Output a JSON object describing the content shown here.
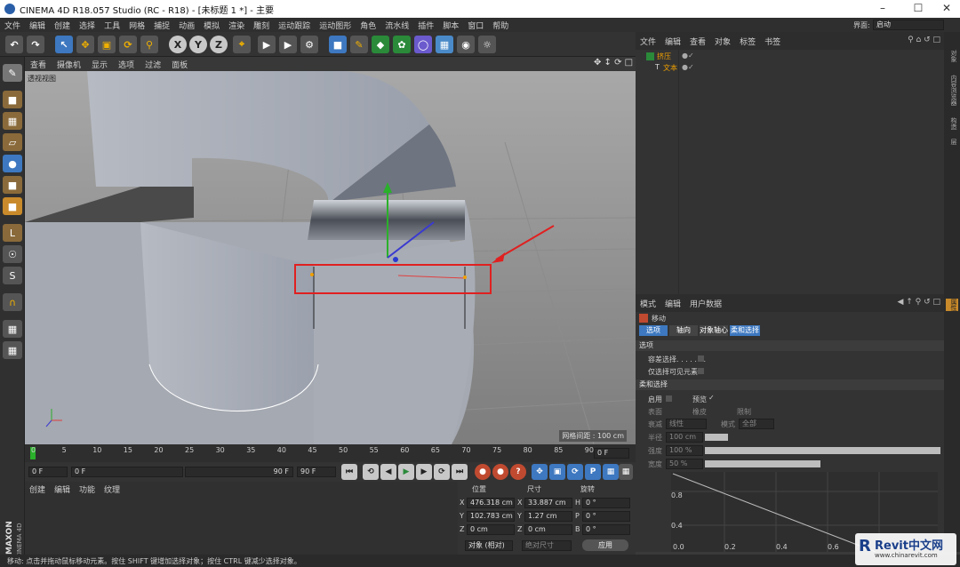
{
  "window": {
    "title": "CINEMA 4D R18.057 Studio (RC - R18) - [未标题 1 *] - 主要"
  },
  "menubar": {
    "items": [
      "文件",
      "编辑",
      "创建",
      "选择",
      "工具",
      "网格",
      "捕捉",
      "动画",
      "模拟",
      "渲染",
      "雕刻",
      "运动跟踪",
      "运动图形",
      "角色",
      "流水线",
      "插件",
      "脚本",
      "窗口",
      "帮助"
    ],
    "layout_label": "界面:",
    "layout_value": "启动"
  },
  "toolbar": {
    "axis_x": "X",
    "axis_y": "Y",
    "axis_z": "Z"
  },
  "viewport": {
    "menu": [
      "查看",
      "摄像机",
      "显示",
      "选项",
      "过滤",
      "面板"
    ],
    "name": "透视视图",
    "grid_spacing": "网格间距 : 100 cm"
  },
  "object_manager": {
    "menu": [
      "文件",
      "编辑",
      "查看",
      "对象",
      "标签",
      "书签"
    ],
    "objects": [
      {
        "name": "挤压"
      },
      {
        "name": "文本"
      }
    ]
  },
  "right_strip": {
    "tabs": [
      "对象",
      "内容浏览器",
      "构造",
      "层",
      "属性"
    ]
  },
  "attributes": {
    "menu": [
      "模式",
      "编辑",
      "用户数据"
    ],
    "tool_name": "移动",
    "tabs": [
      "选项",
      "轴向",
      "对象轴心",
      "柔和选择"
    ],
    "section_options": "选项",
    "preserve_groups": "容差选择. . . . . . .",
    "only_visible": "仅选择可见元素",
    "section_soft": "柔和选择",
    "enable": "启用",
    "preview": "预览",
    "surface": "表面",
    "rubber": "橡皮",
    "restrict": "限制",
    "mode_label": "衰减",
    "mode_value": "线性",
    "shape_label": "模式",
    "shape_value": "全部",
    "radius_label": "半径",
    "radius_value": "100 cm",
    "strength_label": "强度",
    "strength_value": "100 %",
    "width_label": "宽度",
    "width_value": "50 %",
    "graph_y1": "0.8",
    "graph_y2": "0.4",
    "graph_x": [
      "0.0",
      "0.2",
      "0.4",
      "0.6",
      "0.8"
    ]
  },
  "timeline": {
    "ticks": [
      "0",
      "5",
      "10",
      "15",
      "20",
      "25",
      "30",
      "35",
      "40",
      "45",
      "50",
      "55",
      "60",
      "65",
      "70",
      "75",
      "80",
      "85",
      "90"
    ],
    "current_frame": "0 F"
  },
  "transport": {
    "start": "0 F",
    "scrub_start": "0 F",
    "scrub_end": "90 F",
    "end": "90 F",
    "max": "90 F"
  },
  "material_manager": {
    "menu": [
      "创建",
      "编辑",
      "功能",
      "纹理"
    ]
  },
  "coordinates": {
    "headers": [
      "位置",
      "尺寸",
      "旋转"
    ],
    "rows": [
      {
        "axis": "X",
        "pos": "476.318 cm",
        "size": "33.887 cm",
        "rot_label": "H",
        "rot": "0 °"
      },
      {
        "axis": "Y",
        "pos": "102.783 cm",
        "size": "1.27 cm",
        "rot_label": "P",
        "rot": "0 °"
      },
      {
        "axis": "Z",
        "pos": "0 cm",
        "size": "0 cm",
        "rot_label": "B",
        "rot": "0 °"
      }
    ],
    "mode": "对象 (相对)",
    "size_mode": "绝对尺寸",
    "apply": "应用"
  },
  "status": {
    "text": "移动: 点击并拖动鼠标移动元素。按住 SHIFT 键增加选择对象；按住 CTRL 键减少选择对象。"
  },
  "brand": {
    "maxon": "MAXON",
    "c4d": "CINEMA 4D"
  },
  "watermark": {
    "logo": "Revit中文网",
    "url": "www.chinarevit.com"
  },
  "colors": {
    "accent_blue": "#3d78c0",
    "highlight_red": "#e02020",
    "panel": "#333333",
    "viewport": "#9c9c9c"
  }
}
